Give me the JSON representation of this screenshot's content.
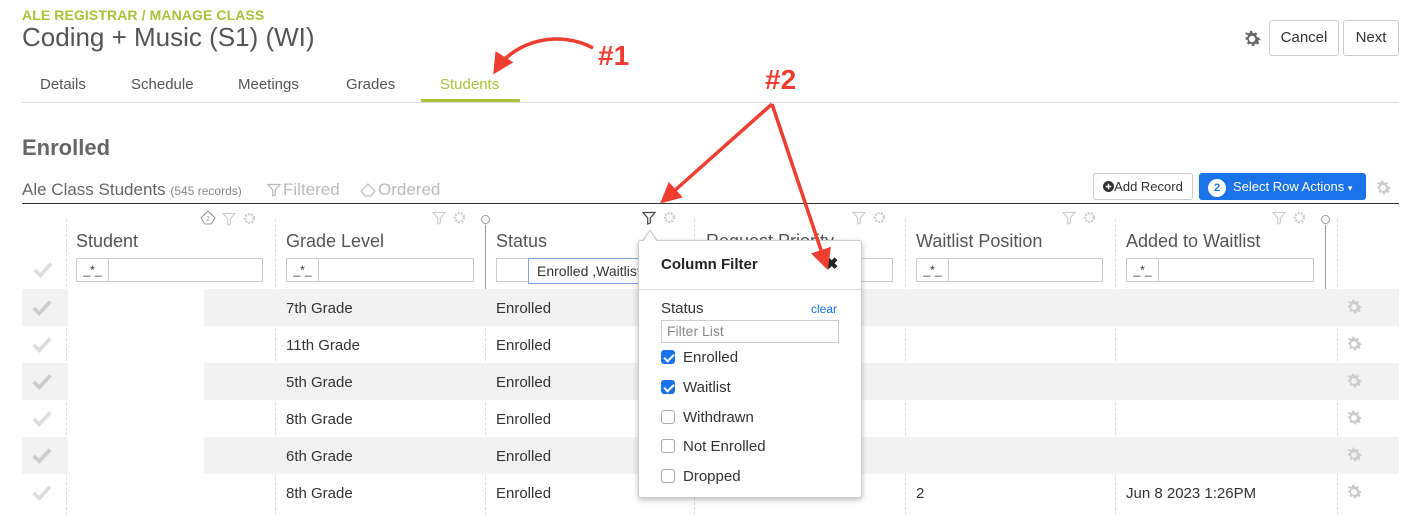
{
  "breadcrumb": "ALE REGISTRAR / MANAGE CLASS",
  "title": "Coding + Music (S1) (WI)",
  "buttons": {
    "cancel": "Cancel",
    "next": "Next"
  },
  "tabs": [
    {
      "label": "Details"
    },
    {
      "label": "Schedule"
    },
    {
      "label": "Meetings"
    },
    {
      "label": "Grades"
    },
    {
      "label": "Students"
    }
  ],
  "active_tab": "Students",
  "section_title": "Enrolled",
  "list": {
    "title": "Ale Class Students",
    "count": "(545 records)",
    "filtered": "Filtered",
    "ordered": "Ordered",
    "add_record": "Add Record",
    "row_actions": "Select Row Actions",
    "row_actions_badge": "2"
  },
  "columns": [
    {
      "label": "Student",
      "filter": "_*_"
    },
    {
      "label": "Grade Level",
      "filter": "_*_"
    },
    {
      "label": "Status",
      "filter": "Enrolled ,Waitlist"
    },
    {
      "label": "Request Priority",
      "filter": "_*_"
    },
    {
      "label": "Waitlist Position",
      "filter": "_*_"
    },
    {
      "label": "Added to Waitlist",
      "filter": "_*_"
    }
  ],
  "rows": [
    {
      "student": "",
      "grade": "7th Grade",
      "status": "Enrolled",
      "priority": "",
      "position": "",
      "added": ""
    },
    {
      "student": "",
      "grade": "11th Grade",
      "status": "Enrolled",
      "priority": "",
      "position": "",
      "added": ""
    },
    {
      "student": "",
      "grade": "5th Grade",
      "status": "Enrolled",
      "priority": "",
      "position": "",
      "added": ""
    },
    {
      "student": "",
      "grade": "8th Grade",
      "status": "Enrolled",
      "priority": "",
      "position": "",
      "added": ""
    },
    {
      "student": "",
      "grade": "6th Grade",
      "status": "Enrolled",
      "priority": "",
      "position": "",
      "added": ""
    },
    {
      "student": "",
      "grade": "8th Grade",
      "status": "Enrolled",
      "priority": "",
      "position": "2",
      "added": "Jun 8 2023 1:26PM"
    }
  ],
  "popup": {
    "title": "Column Filter",
    "close": "✖",
    "field_label": "Status",
    "clear": "clear",
    "search_placeholder": "Filter List",
    "options": [
      {
        "label": "Enrolled",
        "checked": true
      },
      {
        "label": "Waitlist",
        "checked": true
      },
      {
        "label": "Withdrawn",
        "checked": false
      },
      {
        "label": "Not Enrolled",
        "checked": false
      },
      {
        "label": "Dropped",
        "checked": false
      }
    ]
  },
  "annotations": {
    "first": "#1",
    "second": "#2"
  },
  "colors": {
    "accent": "#a8c23a",
    "primary": "#1a73e8",
    "annotation": "#ef3e2f"
  },
  "icons": [
    "gear-icon",
    "filter-icon",
    "ordered-icon",
    "checkmark-icon",
    "plus-circle-icon",
    "caret-down-icon",
    "close-icon",
    "sort-icon"
  ]
}
